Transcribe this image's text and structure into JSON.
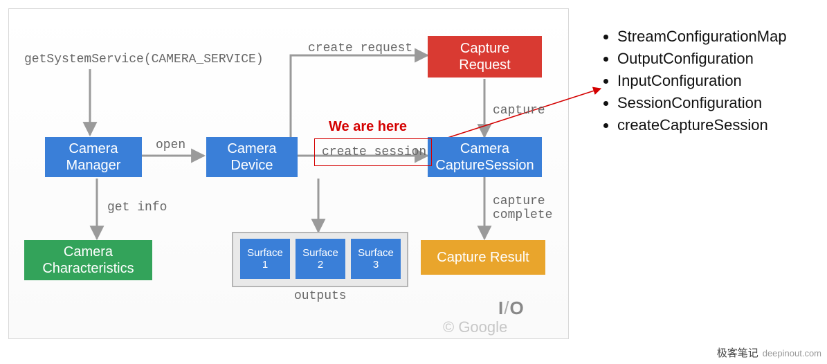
{
  "top_call": "getSystemService(CAMERA_SERVICE)",
  "nodes": {
    "camera_manager": "Camera\nManager",
    "camera_device": "Camera\nDevice",
    "camera_capture_session": "Camera\nCaptureSession",
    "capture_request": "Capture\nRequest",
    "camera_characteristics": "Camera\nCharacteristics",
    "capture_result": "Capture Result",
    "surface1": "Surface\n1",
    "surface2": "Surface\n2",
    "surface3": "Surface\n3"
  },
  "edges": {
    "open": "open",
    "create_request": "create request",
    "capture": "capture",
    "create_session": "create session",
    "get_info": "get info",
    "capture_complete": "capture\ncomplete"
  },
  "outputs_label": "outputs",
  "callout": "We are here",
  "bullets": [
    "StreamConfigurationMap",
    "OutputConfiguration",
    "InputConfiguration",
    "SessionConfiguration",
    "createCaptureSession"
  ],
  "io_logo": {
    "i": "I",
    "slash": "/",
    "o": "O"
  },
  "copyright": "© Google",
  "watermark": {
    "cn": "极客笔记",
    "dom": "deepinout.com"
  }
}
